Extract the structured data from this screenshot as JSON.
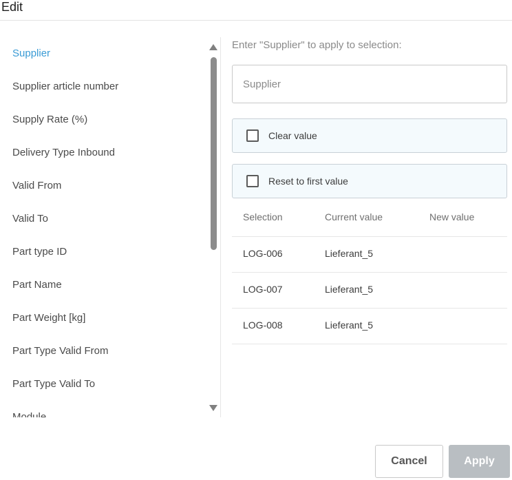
{
  "dialog": {
    "title": "Edit"
  },
  "fields": [
    {
      "label": "Supplier",
      "active": true
    },
    {
      "label": "Supplier article number"
    },
    {
      "label": "Supply Rate (%)"
    },
    {
      "label": "Delivery Type Inbound"
    },
    {
      "label": "Valid From"
    },
    {
      "label": "Valid To"
    },
    {
      "label": "Part type ID"
    },
    {
      "label": "Part Name"
    },
    {
      "label": "Part Weight [kg]"
    },
    {
      "label": "Part Type Valid From"
    },
    {
      "label": "Part Type Valid To"
    },
    {
      "label": "Module"
    }
  ],
  "editor": {
    "instruction": "Enter \"Supplier\" to apply to selection:",
    "input_placeholder": "Supplier",
    "input_value": "",
    "clear_value_label": "Clear value",
    "reset_label": "Reset to first value"
  },
  "table": {
    "headers": [
      "Selection",
      "Current value",
      "New value"
    ],
    "rows": [
      [
        "LOG-006",
        "Lieferant_5",
        ""
      ],
      [
        "LOG-007",
        "Lieferant_5",
        ""
      ],
      [
        "LOG-008",
        "Lieferant_5",
        ""
      ]
    ]
  },
  "footer": {
    "cancel_label": "Cancel",
    "apply_label": "Apply"
  },
  "colors": {
    "active_field": "#3a9bd5",
    "apply_disabled": "#b9bec2",
    "checkbox_row_bg": "#f4fafd"
  }
}
